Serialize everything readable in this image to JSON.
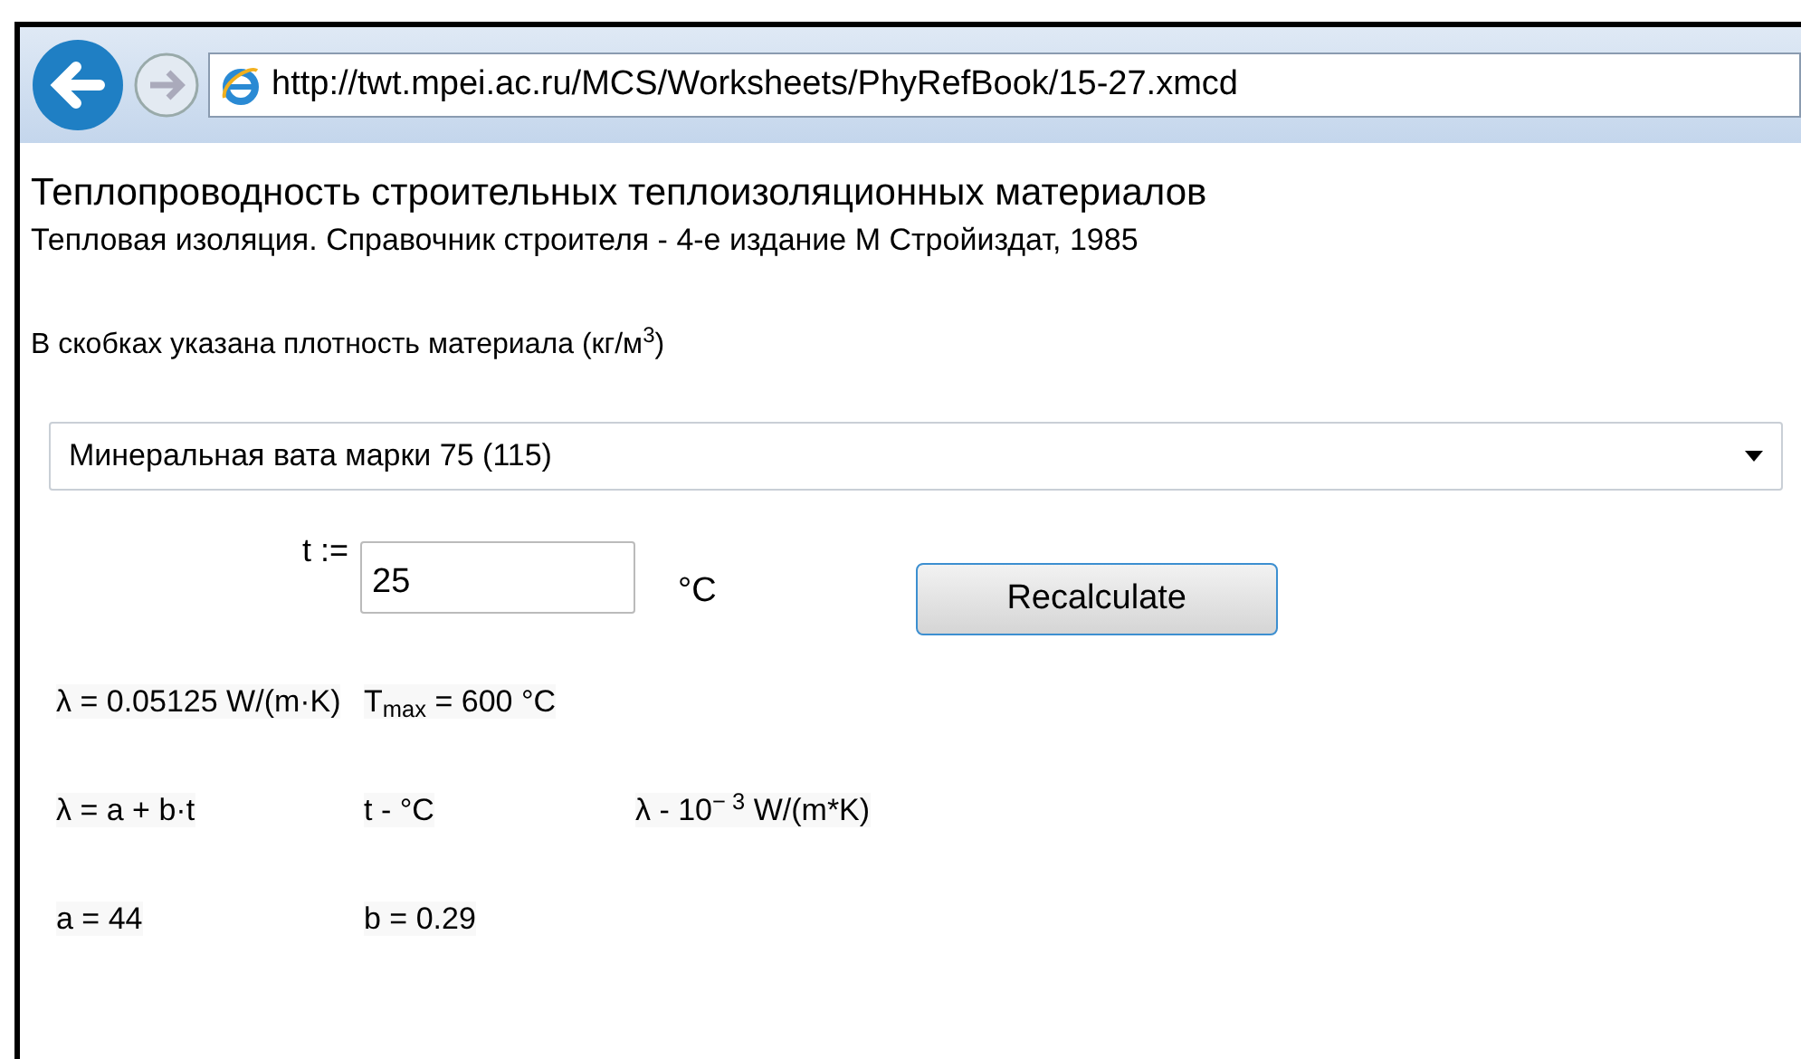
{
  "browser": {
    "address": "http://twt.mpei.ac.ru/MCS/Worksheets/PhyRefBook/15-27.xmcd"
  },
  "page": {
    "title": "Теплопроводность строительных теплоизоляционных материалов",
    "source": "Тепловая изоляция. Справочник строителя - 4-е издание М Стройиздат, 1985",
    "note": "В скобках указана плотность материала (кг/м$^{3}$)",
    "material_select": {
      "value": "Минеральная вата марки 75 (115)"
    },
    "input_label": "t :=",
    "input_value": "25",
    "input_unit": "°C",
    "button": "Recalculate",
    "result_rows": [
      [
        "λ = 0.05125  W/(m·K)",
        "T$_{max}$ = 600  °C"
      ],
      [
        "λ = a + b·t",
        "t - °C",
        "λ - 10$^{− 3}$ W/(m*K)"
      ],
      [
        "a = 44",
        "b = 0.29"
      ]
    ]
  }
}
